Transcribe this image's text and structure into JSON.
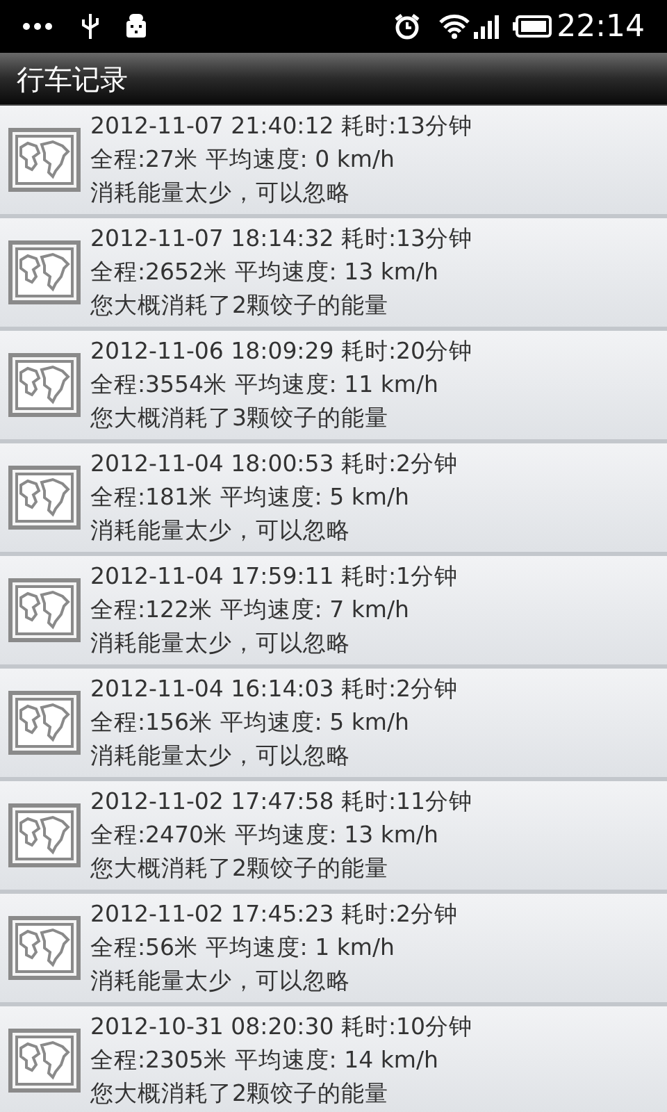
{
  "status_bar": {
    "time": "22:14"
  },
  "title": "行车记录",
  "trips": [
    {
      "header": "2012-11-07 21:40:12 耗时:13分钟",
      "stats": "全程:27米 平均速度: 0 km/h",
      "energy": "消耗能量太少，可以忽略"
    },
    {
      "header": "2012-11-07 18:14:32 耗时:13分钟",
      "stats": "全程:2652米 平均速度: 13 km/h",
      "energy": "您大概消耗了2颗饺子的能量"
    },
    {
      "header": "2012-11-06 18:09:29 耗时:20分钟",
      "stats": "全程:3554米 平均速度: 11 km/h",
      "energy": "您大概消耗了3颗饺子的能量"
    },
    {
      "header": "2012-11-04 18:00:53 耗时:2分钟",
      "stats": "全程:181米 平均速度: 5 km/h",
      "energy": "消耗能量太少，可以忽略"
    },
    {
      "header": "2012-11-04 17:59:11 耗时:1分钟",
      "stats": "全程:122米 平均速度: 7 km/h",
      "energy": "消耗能量太少，可以忽略"
    },
    {
      "header": "2012-11-04 16:14:03 耗时:2分钟",
      "stats": "全程:156米 平均速度: 5 km/h",
      "energy": "消耗能量太少，可以忽略"
    },
    {
      "header": "2012-11-02 17:47:58 耗时:11分钟",
      "stats": "全程:2470米 平均速度: 13 km/h",
      "energy": "您大概消耗了2颗饺子的能量"
    },
    {
      "header": "2012-11-02 17:45:23 耗时:2分钟",
      "stats": "全程:56米 平均速度: 1 km/h",
      "energy": "消耗能量太少，可以忽略"
    },
    {
      "header": "2012-10-31 08:20:30 耗时:10分钟",
      "stats": "全程:2305米 平均速度: 14 km/h",
      "energy": "您大概消耗了2颗饺子的能量"
    }
  ]
}
